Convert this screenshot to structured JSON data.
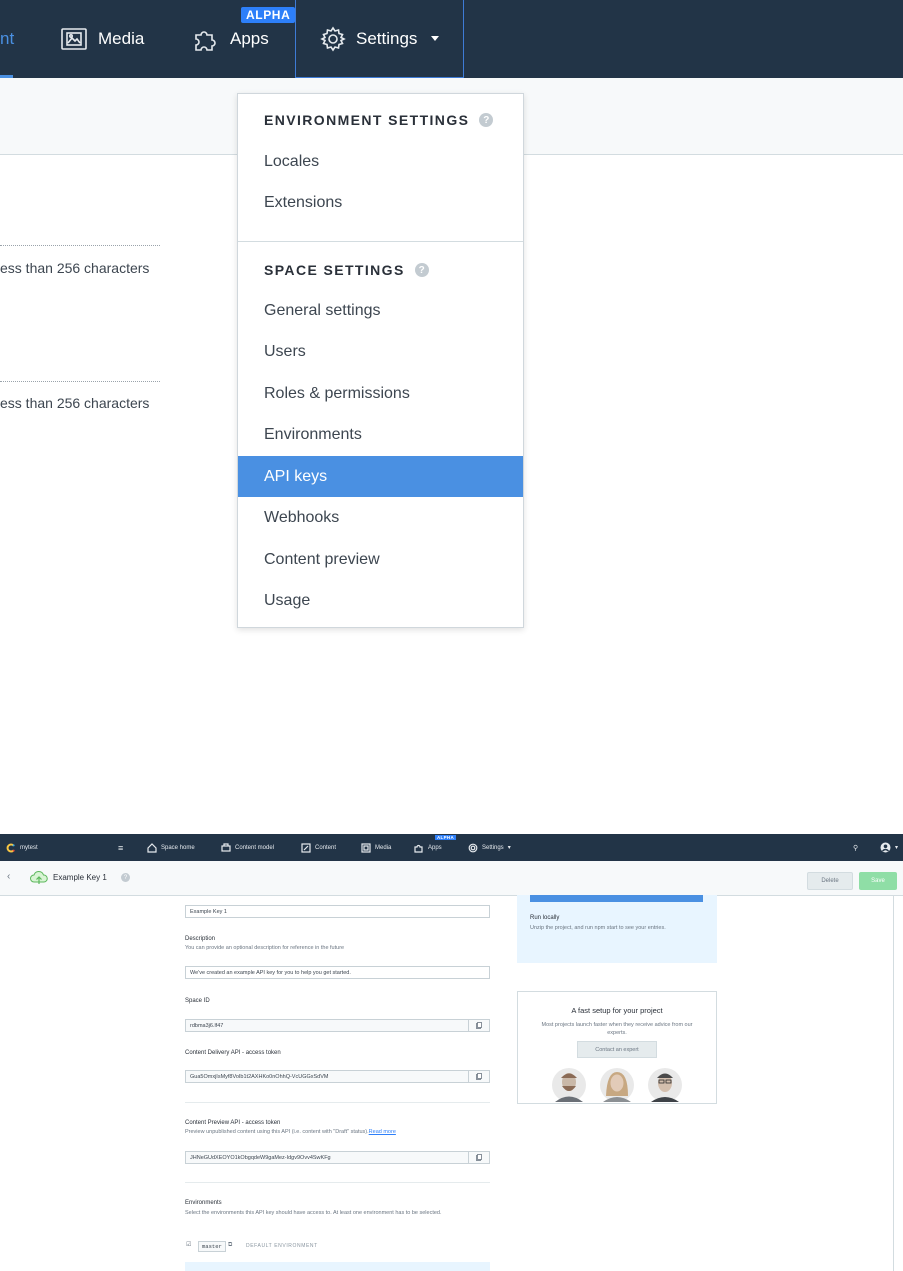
{
  "zoom": {
    "nav": {
      "active_partial_label": "nt",
      "media_label": "Media",
      "apps_label": "Apps",
      "alpha_badge": "ALPHA",
      "settings_label": "Settings"
    },
    "left_hint": "ess than 256 characters",
    "dropdown": {
      "env_section": "ENVIRONMENT SETTINGS",
      "env_items": [
        "Locales",
        "Extensions"
      ],
      "space_section": "SPACE SETTINGS",
      "space_items": [
        "General settings",
        "Users",
        "Roles & permissions",
        "Environments",
        "API keys",
        "Webhooks",
        "Content preview",
        "Usage"
      ],
      "active_item": "API keys"
    }
  },
  "mini": {
    "nav": {
      "space_name": "mytest",
      "items": [
        "Space home",
        "Content model",
        "Content",
        "Media",
        "Apps",
        "Settings"
      ],
      "alpha_badge": "ALPHA"
    },
    "subbar": {
      "title": "Example Key 1",
      "delete_label": "Delete",
      "save_label": "Save"
    },
    "form": {
      "name_value": "Example Key 1",
      "description_label": "Description",
      "description_sub": "You can provide an optional description for reference in the future",
      "description_value": "We've created an example API key for you to help you get started.",
      "space_id_label": "Space ID",
      "space_id_value": "rdbma3j6.lf47",
      "cda_label": "Content Delivery API - access token",
      "cda_value": "Gua5OmxjIsMyf8VoIb1t2AXHKo0nOhhQ-VcUGGxSdVM",
      "cpa_label": "Content Preview API - access token",
      "cpa_sub": "Preview unpublished content using this API (i.e. content with \"Draft\" status).",
      "cpa_link": "Read more",
      "cpa_value": "JHNeGUdXEOYO1kObgqdeW9gaMez-Idgv9Ovv4SwKFg",
      "env_label": "Environments",
      "env_sub": "Select the environments this API key should have access to. At least one environment has to be selected.",
      "env_tag": "master",
      "env_default": "DEFAULT ENVIRONMENT"
    },
    "sidebar": {
      "run_locally_title": "Run locally",
      "run_locally_text": "Unzip the project, and run npm start to see your entries.",
      "setup_title": "A fast setup for your project",
      "setup_text": "Most projects launch faster when they receive advice from our experts.",
      "contact_button": "Contact an expert"
    }
  }
}
